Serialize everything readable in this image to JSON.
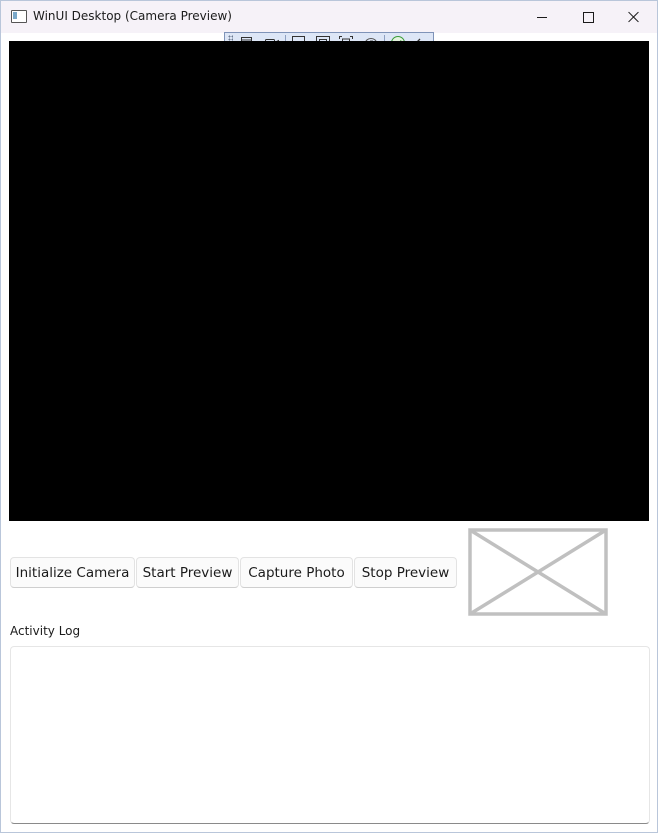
{
  "window": {
    "title": "WinUI Desktop (Camera Preview)"
  },
  "debug_toolbar": {
    "items": [
      "grip",
      "live-visual-tree-icon",
      "video-icon",
      "select-element-icon",
      "display-layout-adorners-icon",
      "track-focus-icon",
      "hot-reload-icon",
      "check-icon",
      "collapse-icon"
    ]
  },
  "buttons": {
    "initialize": "Initialize Camera",
    "start_preview": "Start Preview",
    "capture_photo": "Capture Photo",
    "stop_preview": "Stop Preview"
  },
  "log": {
    "label": "Activity Log",
    "content": ""
  },
  "colors": {
    "preview_background": "#000000",
    "toolbar_background": "#dde6f6",
    "placeholder_stroke": "#c0c0c0",
    "check_green": "#3a9b3a"
  }
}
